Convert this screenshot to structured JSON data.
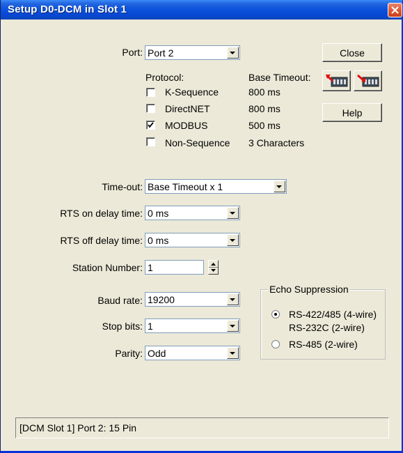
{
  "window": {
    "title": "Setup D0-DCM in Slot 1"
  },
  "port": {
    "label": "Port:",
    "value": "Port 2"
  },
  "protocol": {
    "header": "Protocol:",
    "timeout_header": "Base Timeout:",
    "items": [
      {
        "name": "K-Sequence",
        "timeout": "800 ms",
        "checked": false
      },
      {
        "name": "DirectNET",
        "timeout": "800 ms",
        "checked": true
      },
      {
        "name": "MODBUS",
        "timeout": "500 ms",
        "checked": true
      },
      {
        "name": "Non-Sequence",
        "timeout": "3 Characters",
        "checked": false
      }
    ]
  },
  "buttons": {
    "close": "Close",
    "help": "Help",
    "read_icon": "read-from-plc-icon",
    "write_icon": "write-to-plc-icon"
  },
  "timeout": {
    "label": "Time-out:",
    "value": "Base Timeout x 1"
  },
  "rts_on": {
    "label": "RTS on delay time:",
    "value": "0 ms"
  },
  "rts_off": {
    "label": "RTS off delay time:",
    "value": "0 ms"
  },
  "station": {
    "label": "Station Number:",
    "value": "1"
  },
  "baud": {
    "label": "Baud rate:",
    "value": "19200"
  },
  "stop_bits": {
    "label": "Stop bits:",
    "value": "1"
  },
  "parity": {
    "label": "Parity:",
    "value": "Odd"
  },
  "echo": {
    "title": "Echo Suppression",
    "option1_line1": "RS-422/485 (4-wire)",
    "option1_line2": "RS-232C (2-wire)",
    "option2": "RS-485 (2-wire)",
    "selected": 1
  },
  "status": "[DCM Slot 1] Port 2: 15 Pin",
  "colors": {
    "titlebar": "#0a52db",
    "face": "#ece9d8"
  }
}
